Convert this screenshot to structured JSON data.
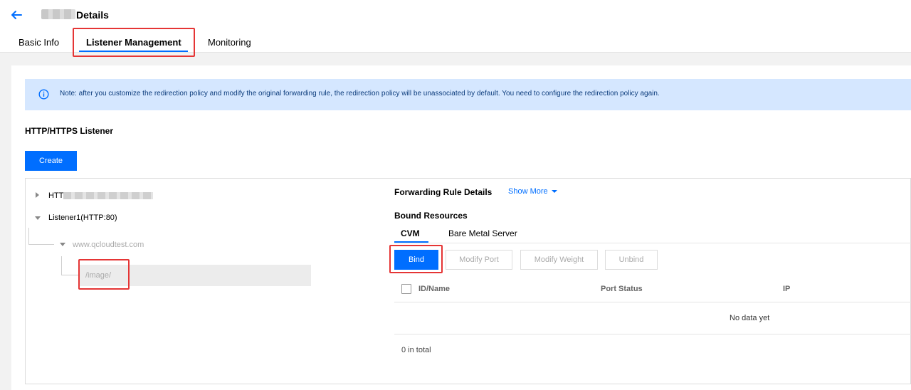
{
  "header": {
    "title": "Details"
  },
  "tabs": [
    {
      "label": "Basic Info"
    },
    {
      "label": "Listener Management"
    },
    {
      "label": "Monitoring"
    }
  ],
  "notice": {
    "text": "Note: after you customize the redirection policy and modify the original forwarding rule, the redirection policy will be unassociated by default. You need to configure the redirection policy again."
  },
  "listener_section": {
    "title": "HTTP/HTTPS Listener",
    "create_label": "Create"
  },
  "tree": {
    "items": [
      {
        "label": "HTT"
      },
      {
        "label": "Listener1(HTTP:80)"
      },
      {
        "label": "www.qcloudtest.com"
      },
      {
        "label": "/image/"
      }
    ]
  },
  "detail": {
    "forwarding_title": "Forwarding Rule Details",
    "show_more": "Show More",
    "bound_title": "Bound Resources",
    "subtabs": [
      {
        "label": "CVM"
      },
      {
        "label": "Bare Metal Server"
      }
    ],
    "actions": {
      "bind": "Bind",
      "modify_port": "Modify Port",
      "modify_weight": "Modify Weight",
      "unbind": "Unbind"
    },
    "columns": [
      "ID/Name",
      "Port Status",
      "IP"
    ],
    "empty": "No data yet",
    "total": "0 in total"
  },
  "colors": {
    "accent": "#006eff",
    "highlight": "#e53535",
    "notice_bg": "#d5e7ff"
  },
  "icons": {
    "back": "arrow-left-icon",
    "info": "info-circle-icon",
    "show_more": "chevron-down-icon",
    "tree_collapsed": "caret-right-icon",
    "tree_expanded": "caret-down-icon"
  }
}
